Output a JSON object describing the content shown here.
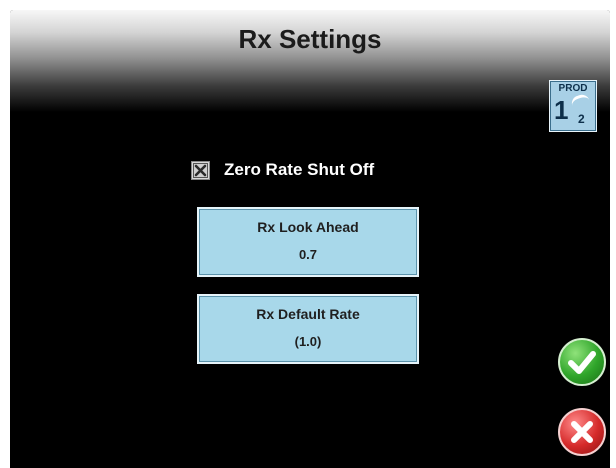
{
  "header": {
    "title": "Rx Settings"
  },
  "product_badge": {
    "label": "PROD",
    "number": "1",
    "sub": "2"
  },
  "zero_rate": {
    "label": "Zero Rate Shut Off",
    "checked": true
  },
  "settings": [
    {
      "label": "Rx Look Ahead",
      "value": "0.7"
    },
    {
      "label": "Rx Default Rate",
      "value": "(1.0)"
    }
  ],
  "actions": {
    "ok_icon": "checkmark-icon",
    "cancel_icon": "x-icon"
  },
  "colors": {
    "button_fill": "#a8d8ea",
    "accept": "#2fa52a",
    "cancel": "#d52a2a",
    "background": "#000000"
  }
}
